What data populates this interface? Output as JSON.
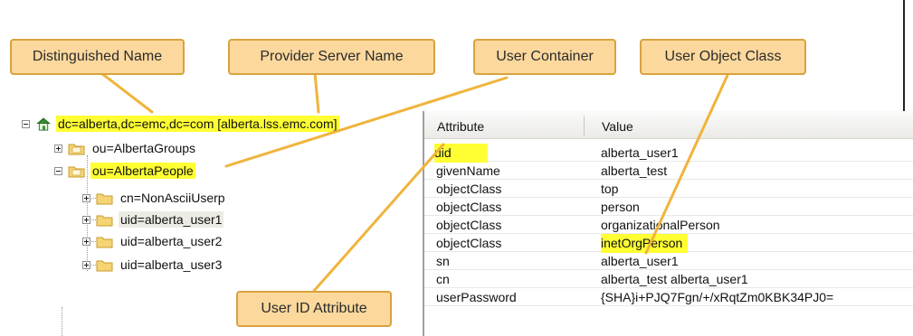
{
  "callouts": {
    "distinguished_name": "Distinguished Name",
    "provider_server_name": "Provider Server Name",
    "user_container": "User Container",
    "user_object_class": "User Object Class",
    "user_id_attribute": "User ID Attribute"
  },
  "tree": {
    "root": "dc=alberta,dc=emc,dc=com [alberta.lss.emc.com]",
    "groups": "ou=AlbertaGroups",
    "people": "ou=AlbertaPeople",
    "children": [
      "cn=NonAsciiUserp",
      "uid=alberta_user1",
      "uid=alberta_user2",
      "uid=alberta_user3"
    ]
  },
  "grid": {
    "col_attribute": "Attribute",
    "col_value": "Value",
    "rows": [
      {
        "attr": "uid",
        "value": "alberta_user1"
      },
      {
        "attr": "givenName",
        "value": "alberta_test"
      },
      {
        "attr": "objectClass",
        "value": "top"
      },
      {
        "attr": "objectClass",
        "value": "person"
      },
      {
        "attr": "objectClass",
        "value": "organizationalPerson"
      },
      {
        "attr": "objectClass",
        "value": "inetOrgPerson"
      },
      {
        "attr": "sn",
        "value": "alberta_user1"
      },
      {
        "attr": "cn",
        "value": "alberta_test alberta_user1"
      },
      {
        "attr": "userPassword",
        "value": "{SHA}i+PJQ7Fgn/+/xRqtZm0KBK34PJ0="
      }
    ]
  },
  "colors": {
    "highlight": "#ffff33",
    "callout_fill": "#fcd89d",
    "callout_border": "#d9a23d",
    "leader": "#f0b43c"
  }
}
